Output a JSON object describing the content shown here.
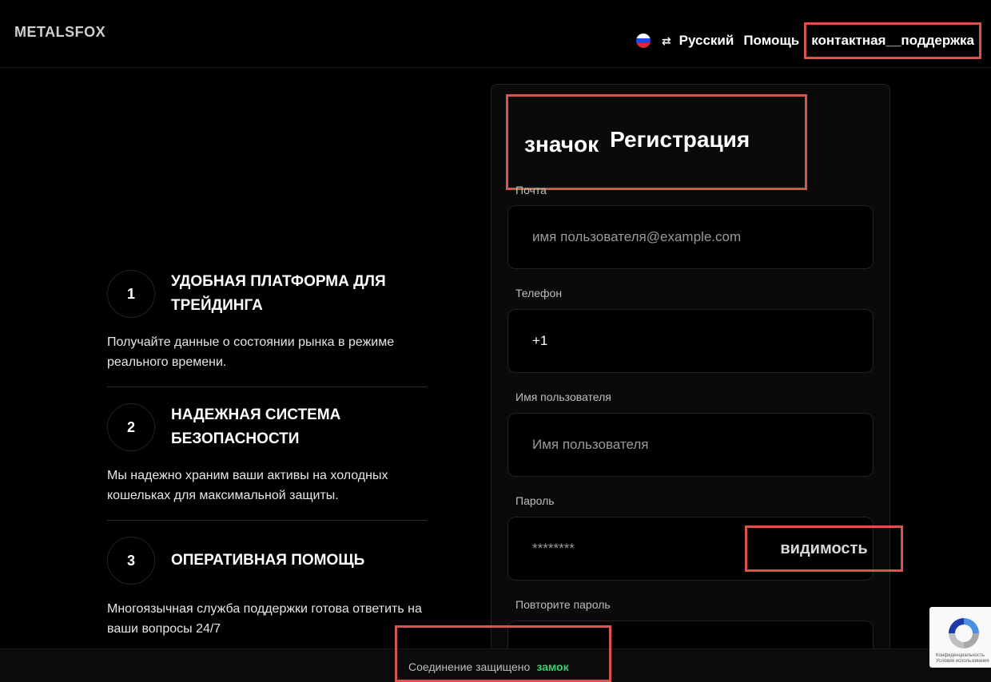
{
  "header": {
    "logo": "METALSFOX",
    "language": "Русский",
    "help": "Помощь",
    "support": "контактная__поддержка"
  },
  "features": [
    {
      "number": "1",
      "title": "УДОБНАЯ ПЛАТФОРМА ДЛЯ ТРЕЙДИНГА",
      "description": "Получайте данные о состоянии рынка в режиме реального времени."
    },
    {
      "number": "2",
      "title": "НАДЕЖНАЯ СИСТЕМА БЕЗОПАСНОСТИ",
      "description": "Мы надежно храним ваши активы на холодных кошельках для максимальной защиты."
    },
    {
      "number": "3",
      "title": "ОПЕРАТИВНАЯ ПОМОЩЬ",
      "description": "Многоязычная служба поддержки готова ответить на ваши вопросы 24/7"
    }
  ],
  "form": {
    "icon_label": "значок",
    "title": "Регистрация",
    "email": {
      "label": "Почта",
      "placeholder": "имя пользователя@example.com"
    },
    "phone": {
      "label": "Телефон",
      "value": "+1"
    },
    "username": {
      "label": "Имя пользователя",
      "placeholder": "Имя пользователя"
    },
    "password": {
      "label": "Пароль",
      "placeholder": "********",
      "visibility_label": "видимость"
    },
    "repeat_password": {
      "label": "Повторите пароль"
    }
  },
  "footer": {
    "secure_text": "Соединение защищено",
    "lock_label": "замок"
  },
  "recaptcha": {
    "privacy": "Конфиденциальность",
    "terms": "Условия использования"
  },
  "colors": {
    "background": "#000000",
    "highlight_border": "#d9534f",
    "secure_green": "#3ccf6e"
  }
}
